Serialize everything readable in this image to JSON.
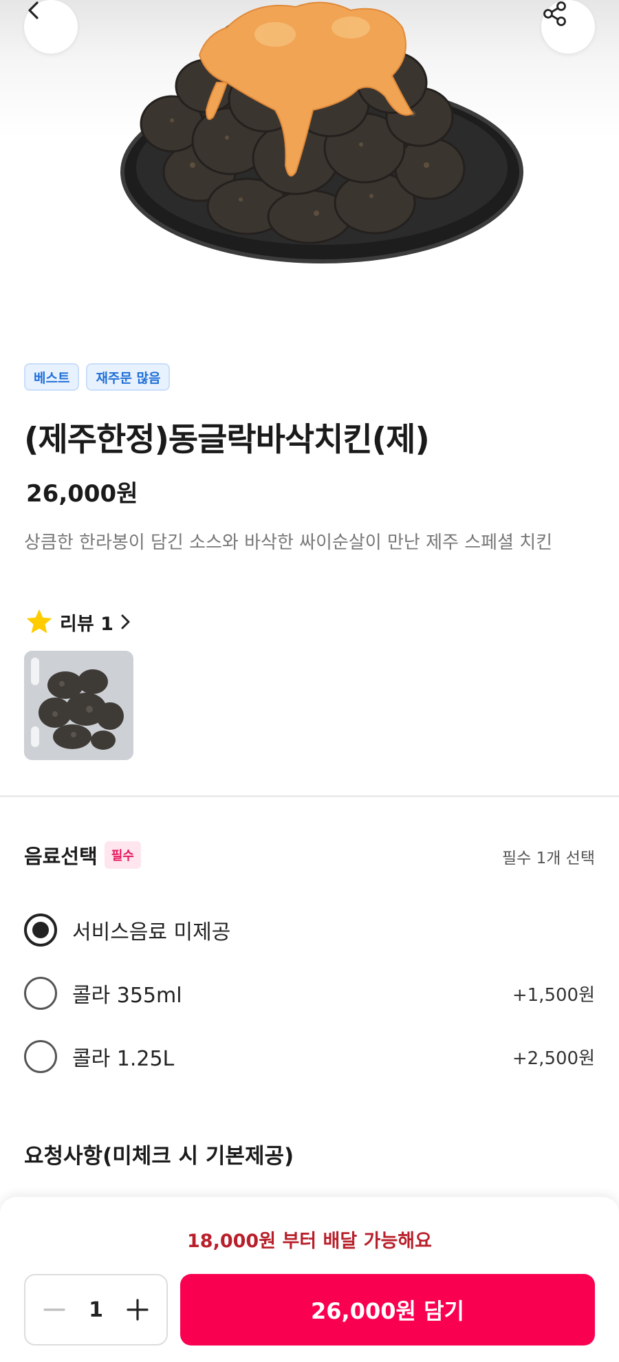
{
  "colors": {
    "accent": "#fa0050",
    "min_order_text": "#b81f2a",
    "badge_blue": "#1f6fd8",
    "required_pink": "#e8175d"
  },
  "header": {
    "back_icon": "chevron-left-icon",
    "share_icon": "share-icon"
  },
  "product": {
    "badges": [
      "베스트",
      "재주문 많음"
    ],
    "title": "(제주한정)동글락바삭치킨(제)",
    "price": "26,000원",
    "description": "상큼한 한라봉이 담긴 소스와 바삭한 싸이순살이 만난 제주 스페셜 치킨",
    "review_label": "리뷰 1"
  },
  "beverage": {
    "title": "음료선택",
    "required_badge": "필수",
    "hint": "필수 1개 선택",
    "selected_index": 0,
    "options": [
      {
        "label": "서비스음료 미제공",
        "price": ""
      },
      {
        "label": "콜라 355ml",
        "price": "+1,500원"
      },
      {
        "label": "콜라 1.25L",
        "price": "+2,500원"
      }
    ]
  },
  "requests": {
    "title": "요청사항(미체크 시 기본제공)"
  },
  "bottom": {
    "min_order": "18,000원 부터 배달 가능해요",
    "quantity": "1",
    "add_button": "26,000원 담기"
  }
}
